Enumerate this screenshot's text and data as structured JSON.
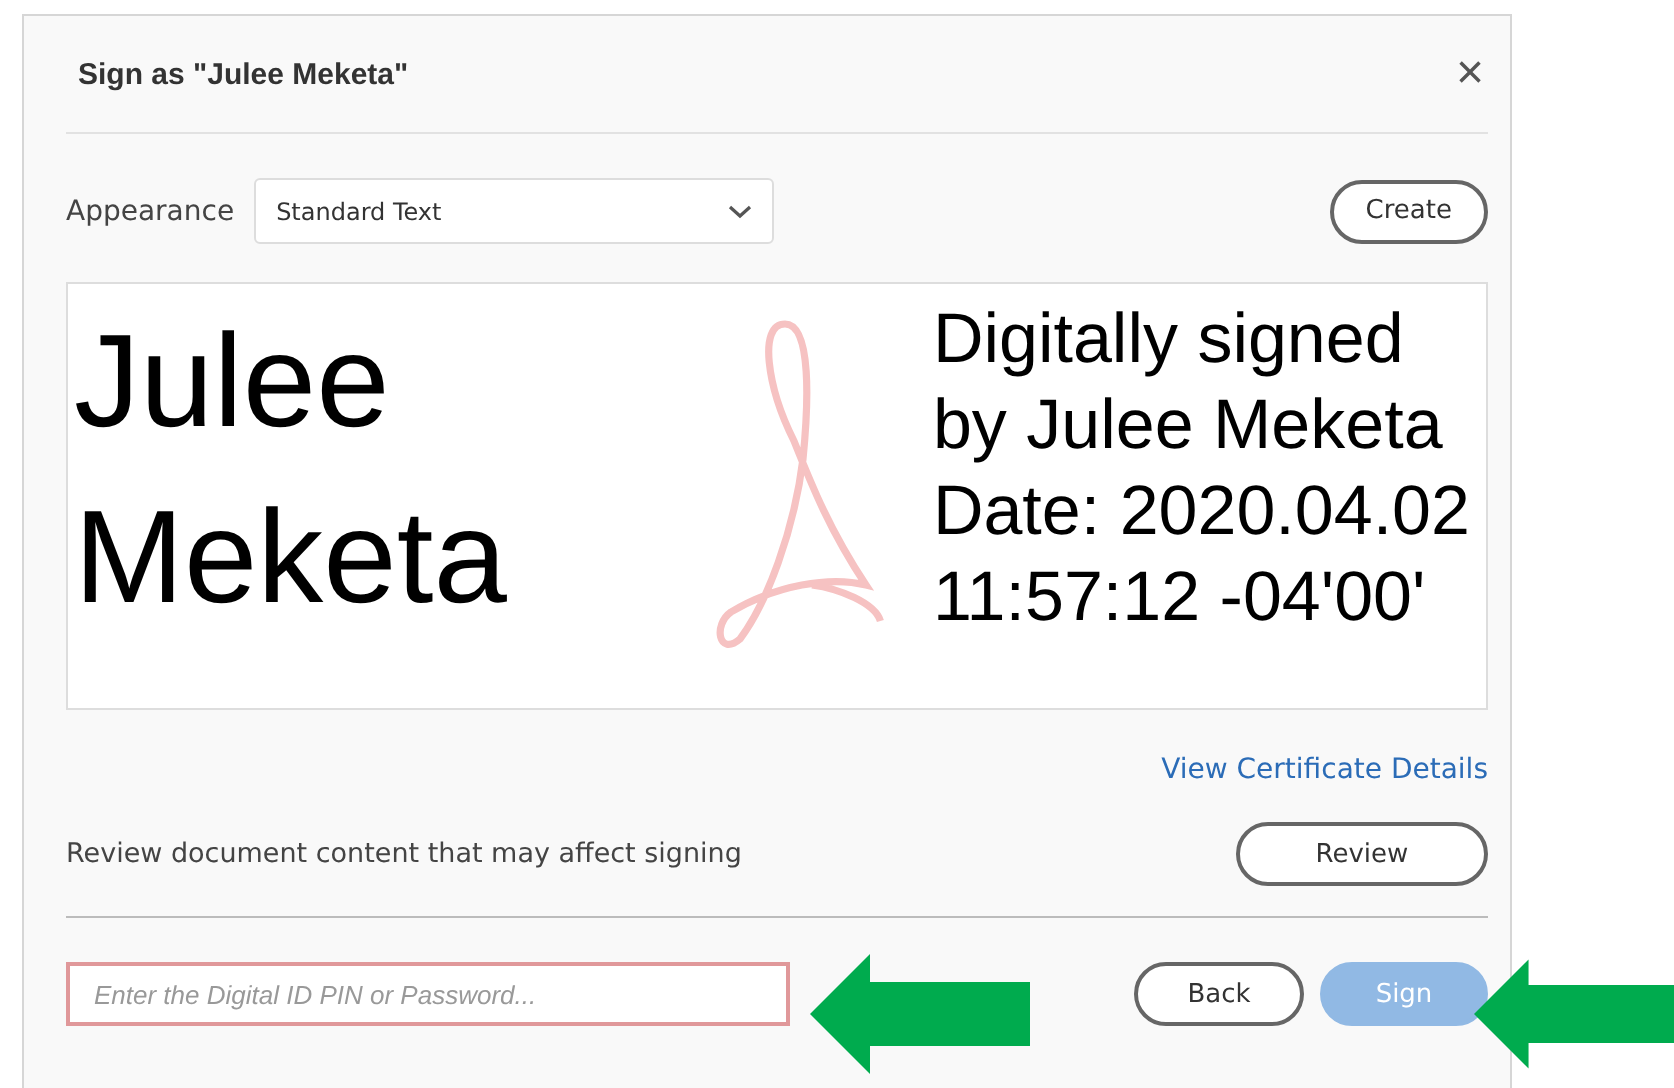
{
  "dialog": {
    "title": "Sign as \"Julee Meketa\"",
    "close": "×"
  },
  "appearance": {
    "label": "Appearance",
    "value": "Standard Text",
    "create_button": "Create"
  },
  "preview": {
    "name_lines": [
      "Julee",
      "Meketa"
    ],
    "detail_lines": [
      "Digitally signed",
      "by Julee Meketa",
      "Date: 2020.04.02",
      "11:57:12 -04'00'"
    ]
  },
  "certificate_link": "View Certificate Details",
  "review": {
    "text": "Review document content that may affect signing",
    "button": "Review"
  },
  "pin_field": {
    "placeholder": "Enter the Digital ID PIN or Password..."
  },
  "buttons": [
    {
      "label": "Back",
      "kind": "secondary",
      "disabled": false
    },
    {
      "label": "Sign",
      "kind": "primary",
      "disabled": true
    }
  ]
}
